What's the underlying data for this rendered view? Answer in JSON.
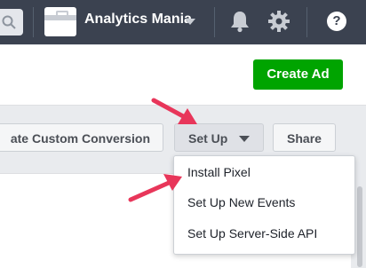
{
  "topbar": {
    "account_name": "Analytics Mania",
    "icons": [
      "search-icon",
      "account-icon",
      "chevron-down-icon",
      "bell-icon",
      "gear-icon",
      "help-icon"
    ],
    "help_glyph": "?"
  },
  "header": {
    "create_ad_label": "Create Ad"
  },
  "toolbar": {
    "custom_conversion_label": "ate Custom Conversion",
    "setup_label": "Set Up",
    "share_label": "Share"
  },
  "setup_menu": {
    "items": [
      {
        "label": "Install Pixel"
      },
      {
        "label": "Set Up New Events"
      },
      {
        "label": "Set Up Server-Side API"
      }
    ]
  },
  "colors": {
    "topbar": "#3b4250",
    "create_ad": "#00a400",
    "arrow": "#e8365a"
  }
}
